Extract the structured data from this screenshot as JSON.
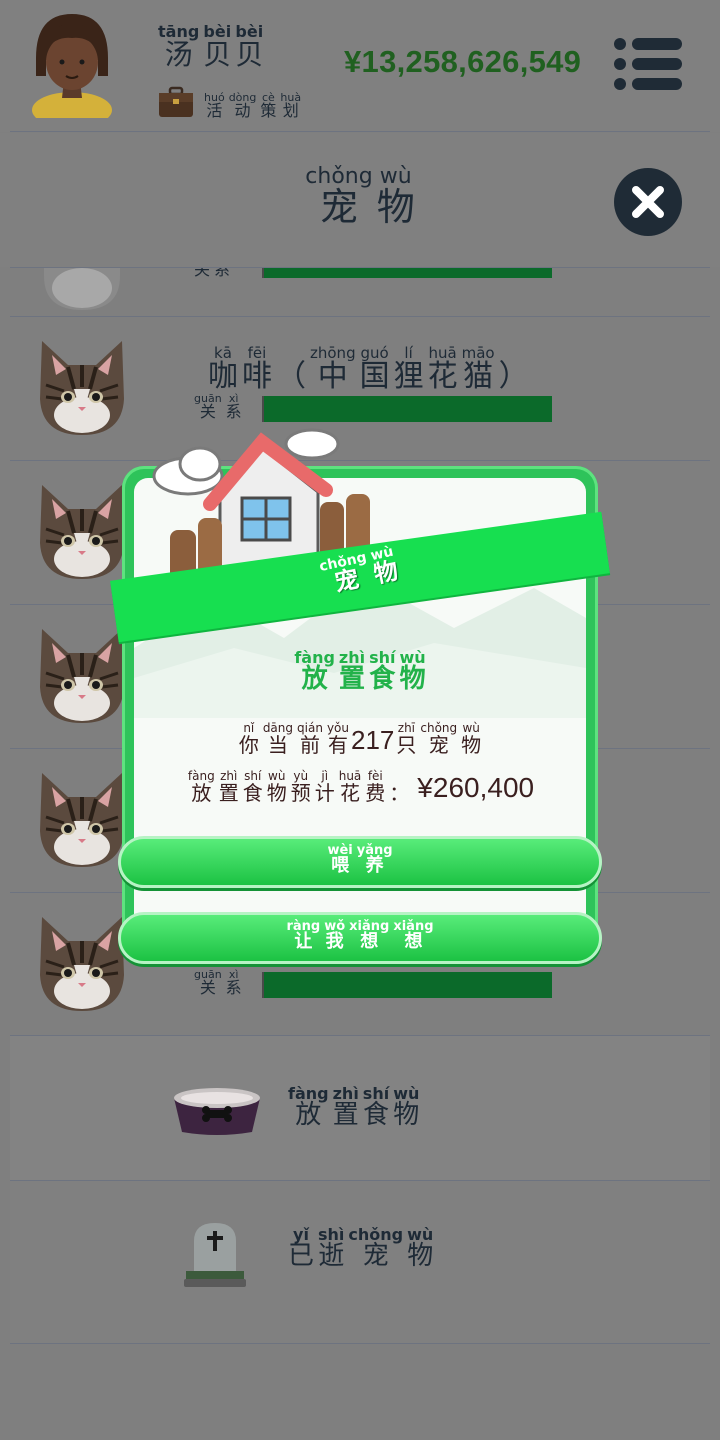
{
  "header": {
    "user_name": [
      [
        "tāng",
        "汤"
      ],
      [
        "bèi",
        "贝"
      ],
      [
        "bèi",
        "贝"
      ]
    ],
    "activity_label": [
      [
        "huó",
        "活"
      ],
      [
        "dòng",
        "动"
      ],
      [
        "cè",
        "策"
      ],
      [
        "huà",
        "划"
      ]
    ],
    "money": "¥13,258,626,549"
  },
  "pets_panel": {
    "title": [
      [
        "chǒng",
        "宠"
      ],
      [
        "wù",
        "物"
      ]
    ]
  },
  "pet_list": {
    "relation_label": [
      [
        "guān",
        "关"
      ],
      [
        "xì",
        "系"
      ]
    ],
    "featured_pet_name": [
      [
        "kā",
        "咖"
      ],
      [
        "fēi",
        "啡"
      ],
      [
        "",
        "（"
      ],
      [
        "zhōng",
        "中"
      ],
      [
        "guó",
        "国"
      ],
      [
        "lí",
        "狸"
      ],
      [
        "huā",
        "花"
      ],
      [
        "māo",
        "猫"
      ],
      [
        "",
        "）"
      ]
    ],
    "food_row_label": [
      [
        "fàng",
        "放"
      ],
      [
        "zhì",
        "置"
      ],
      [
        "shí",
        "食"
      ],
      [
        "wù",
        "物"
      ]
    ],
    "deceased_row_label": [
      [
        "yǐ",
        "已"
      ],
      [
        "shì",
        "逝"
      ],
      [
        "chǒng",
        "宠"
      ],
      [
        "wù",
        "物"
      ]
    ]
  },
  "modal": {
    "ribbon_title": [
      [
        "chǒng",
        "宠"
      ],
      [
        "wù",
        "物"
      ]
    ],
    "heading": [
      [
        "fàng",
        "放"
      ],
      [
        "zhì",
        "置"
      ],
      [
        "shí",
        "食"
      ],
      [
        "wù",
        "物"
      ]
    ],
    "line1_prefix": [
      [
        "nǐ",
        "你"
      ],
      [
        "dāng",
        "当"
      ],
      [
        "qián",
        "前"
      ],
      [
        "yǒu",
        "有"
      ]
    ],
    "pet_count": "217",
    "line1_suffix": [
      [
        "zhī",
        "只"
      ],
      [
        "chǒng",
        "宠"
      ],
      [
        "wù",
        "物"
      ]
    ],
    "line2_prefix": [
      [
        "fàng",
        "放"
      ],
      [
        "zhì",
        "置"
      ],
      [
        "shí",
        "食"
      ],
      [
        "wù",
        "物"
      ],
      [
        "yù",
        "预"
      ],
      [
        "jì",
        "计"
      ],
      [
        "huā",
        "花"
      ],
      [
        "fèi",
        "费"
      ],
      [
        "",
        "："
      ]
    ],
    "cost": "¥260,400",
    "feed_button": [
      [
        "wèi",
        "喂"
      ],
      [
        "yǎng",
        "养"
      ]
    ],
    "think_button": [
      [
        "ràng",
        "让"
      ],
      [
        "wǒ",
        "我"
      ],
      [
        "xiǎng",
        "想"
      ],
      [
        "xiǎng",
        "想"
      ]
    ]
  },
  "colors": {
    "accent_green": "#17df50",
    "money_green": "#206020",
    "relation_bar": "#0b6a2a",
    "dark_navy": "#1e2a36"
  }
}
